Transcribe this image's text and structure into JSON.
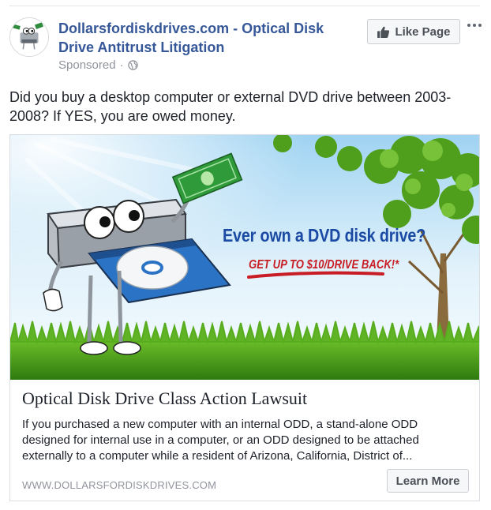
{
  "post": {
    "page_name": "Dollarsfordiskdrives.com - Optical Disk Drive Antitrust Litigation",
    "sponsored_label": "Sponsored",
    "separator": "·",
    "like_button_label": "Like Page",
    "more_menu_icon": "ellipsis-icon",
    "body_text": "Did you buy a desktop computer or external DVD drive between 2003-2008? If YES, you are owed money."
  },
  "card": {
    "image_headline": "Ever own a DVD disk drive?",
    "image_offer": "GET UP TO $10/DRIVE BACK!*",
    "title": "Optical Disk Drive Class Action Lawsuit",
    "description": "If you purchased a new computer with an internal ODD, a stand-alone ODD designed for internal use in a computer, or an ODD designed to be attached externally to a computer while a resident of Arizona, California, District of...",
    "domain": "WWW.DOLLARSFORDISKDRIVES.COM",
    "cta_label": "Learn More"
  },
  "colors": {
    "link_blue": "#365899",
    "text": "#1d2129",
    "muted": "#90949c",
    "headline_blue": "#1a4aa3",
    "offer_red": "#c81d24",
    "grass_green": "#3c8a12"
  }
}
